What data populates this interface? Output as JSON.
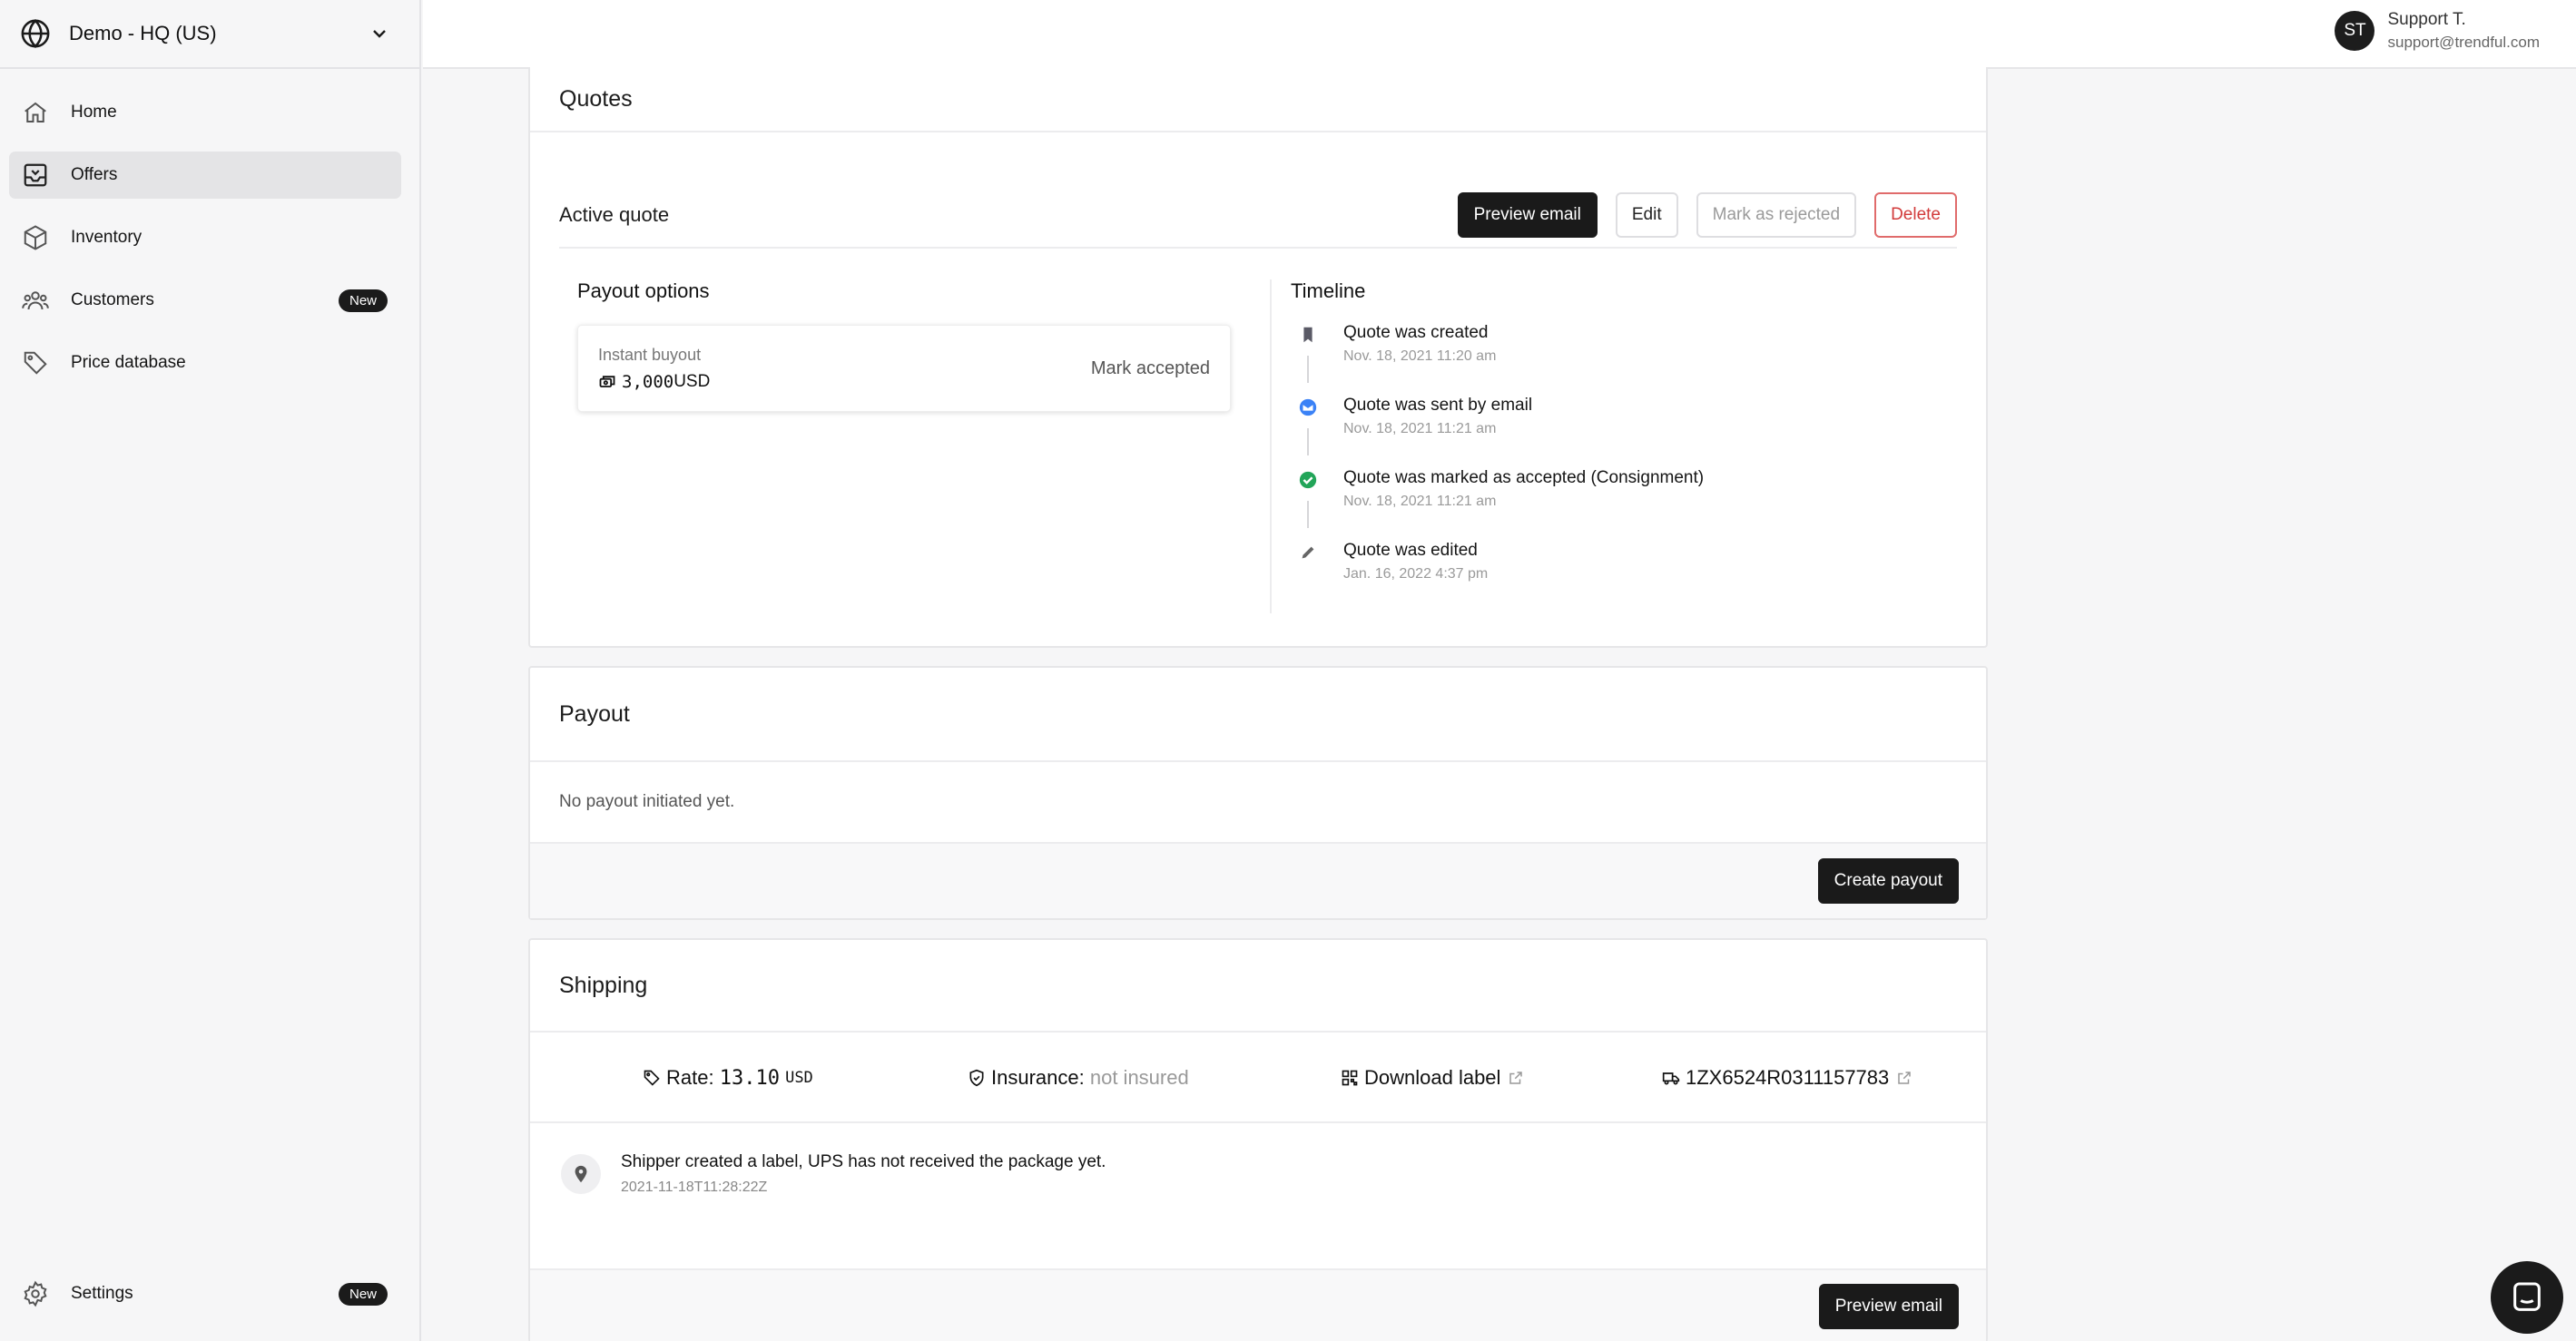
{
  "workspace": {
    "name": "Demo - HQ (US)",
    "icon": "globe-icon"
  },
  "nav": {
    "items": [
      {
        "label": "Home",
        "icon": "home-icon"
      },
      {
        "label": "Offers",
        "icon": "inbox-icon",
        "active": true
      },
      {
        "label": "Inventory",
        "icon": "box-icon"
      },
      {
        "label": "Customers",
        "icon": "users-icon",
        "badge": "New"
      },
      {
        "label": "Price database",
        "icon": "tag-icon"
      }
    ],
    "settings": {
      "label": "Settings",
      "icon": "gear-icon",
      "badge": "New"
    }
  },
  "user": {
    "initials": "ST",
    "name": "Support T.",
    "email": "support@trendful.com"
  },
  "quotes": {
    "title": "Quotes",
    "active_label": "Active quote",
    "buttons": {
      "preview_email": "Preview email",
      "edit": "Edit",
      "mark_rejected": "Mark as rejected",
      "delete": "Delete"
    },
    "payout_options": {
      "title": "Payout options",
      "option": {
        "name": "Instant buyout",
        "amount": "3,000",
        "currency": "USD",
        "action": "Mark accepted"
      }
    },
    "timeline": {
      "title": "Timeline",
      "events": [
        {
          "title": "Quote was created",
          "date": "Nov. 18, 2021 11:20 am",
          "icon": "bookmark-icon",
          "color": "#5a5a66"
        },
        {
          "title": "Quote was sent by email",
          "date": "Nov. 18, 2021 11:21 am",
          "icon": "mail-icon",
          "color": "#3b82f6"
        },
        {
          "title": "Quote was marked as accepted (Consignment)",
          "date": "Nov. 18, 2021 11:21 am",
          "icon": "check-circle-icon",
          "color": "#22a559"
        },
        {
          "title": "Quote was edited",
          "date": "Jan. 16, 2022 4:37 pm",
          "icon": "pencil-icon",
          "color": "#666666"
        }
      ]
    }
  },
  "payout": {
    "title": "Payout",
    "message": "No payout initiated yet.",
    "create_button": "Create payout"
  },
  "shipping": {
    "title": "Shipping",
    "rate_label": "Rate:",
    "rate_value": "13.10",
    "rate_currency": "USD",
    "insurance_label": "Insurance:",
    "insurance_value": "not insured",
    "download_label": "Download label",
    "tracking_number": "1ZX6524R0311157783",
    "status_message": "Shipper created a label, UPS has not received the package yet.",
    "status_date": "2021-11-18T11:28:22Z",
    "preview_button": "Preview email"
  }
}
